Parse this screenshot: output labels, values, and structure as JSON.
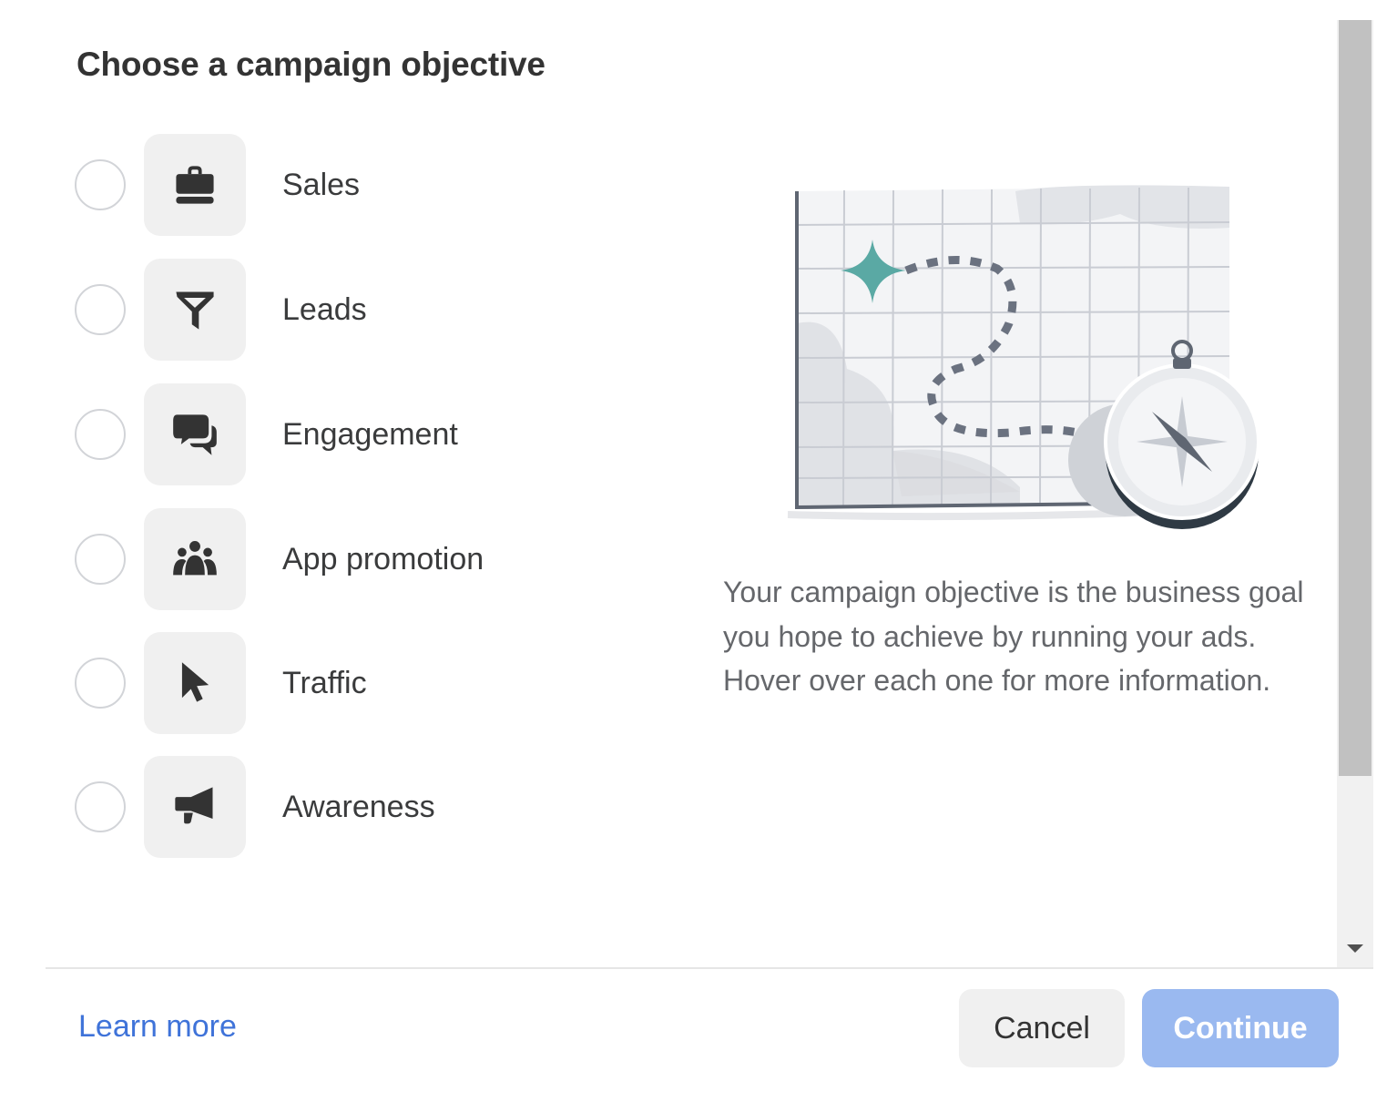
{
  "dialog": {
    "title": "Choose a campaign objective",
    "objectives": [
      {
        "label": "Sales",
        "icon": "shopping-bag-icon",
        "selected": false
      },
      {
        "label": "Leads",
        "icon": "funnel-icon",
        "selected": false
      },
      {
        "label": "Engagement",
        "icon": "chat-bubbles-icon",
        "selected": false
      },
      {
        "label": "App promotion",
        "icon": "people-group-icon",
        "selected": false
      },
      {
        "label": "Traffic",
        "icon": "cursor-arrow-icon",
        "selected": false
      },
      {
        "label": "Awareness",
        "icon": "megaphone-icon",
        "selected": false
      }
    ],
    "illustration": "map-with-compass-illustration",
    "description": "Your campaign objective is the business goal you hope to achieve by running your ads. Hover over each one for more information."
  },
  "footer": {
    "learn_more": "Learn more",
    "cancel_label": "Cancel",
    "continue_label": "Continue",
    "continue_enabled": false
  },
  "colors": {
    "link": "#3f73d9",
    "continue_disabled_bg": "#9ab9f0",
    "accent_star": "#5aa9a4",
    "icon_tile_bg": "#f0f0f0"
  }
}
